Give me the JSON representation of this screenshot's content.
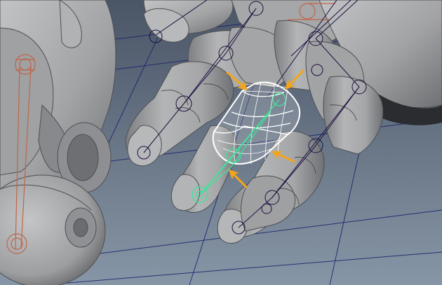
{
  "viewport": {
    "kind": "3d-modeling-viewport",
    "background_top": "#4a5566",
    "background_bottom": "#8796a6",
    "mesh_color": "#a9aaab",
    "mesh_shadow": "#4d4f52",
    "grid_color": "#1a1f6b",
    "joint_color_default": "#1b1040",
    "joint_color_selected": "#3ee39a",
    "joint_color_arm": "#c0664a",
    "selected_mesh_wire": "#ffffff",
    "arrow_color": "#f2a51a",
    "icons": [
      "selection-arrow-icon"
    ]
  }
}
